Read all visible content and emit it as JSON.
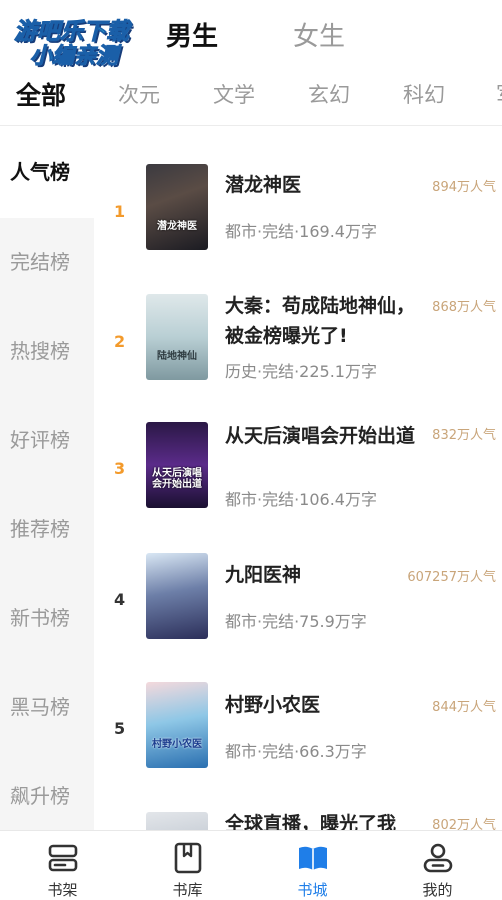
{
  "logo": {
    "line1": "游吧乐下载",
    "line2": "小编亲测"
  },
  "gender_tabs": {
    "male": "男生",
    "female": "女生",
    "active": "male"
  },
  "categories": [
    "全部",
    "次元",
    "文学",
    "玄幻",
    "科幻",
    "军"
  ],
  "rank_types": [
    "人气榜",
    "完结榜",
    "热搜榜",
    "好评榜",
    "推荐榜",
    "新书榜",
    "黑马榜",
    "飙升榜"
  ],
  "books": [
    {
      "rank": "1",
      "title": "潜龙神医",
      "meta": "都市·完结·169.4万字",
      "popularity": "894万人气",
      "cover_text": "潜龙神医"
    },
    {
      "rank": "2",
      "title": "大秦：苟成陆地神仙，被金榜曝光了!",
      "meta": "历史·完结·225.1万字",
      "popularity": "868万人气",
      "cover_text": "陆地神仙"
    },
    {
      "rank": "3",
      "title": "从天后演唱会开始出道",
      "meta": "都市·完结·106.4万字",
      "popularity": "832万人气",
      "cover_text": "从天后演唱会开始出道"
    },
    {
      "rank": "4",
      "title": "九阳医神",
      "meta": "都市·完结·75.9万字",
      "popularity": "607257万人气",
      "cover_text": ""
    },
    {
      "rank": "5",
      "title": "村野小农医",
      "meta": "都市·完结·66.3万字",
      "popularity": "844万人气",
      "cover_text": "村野小农医"
    },
    {
      "rank": "",
      "title": "全球直播，曝光了我",
      "meta": "",
      "popularity": "802万人气",
      "cover_text": ""
    }
  ],
  "bottom_nav": [
    {
      "label": "书架",
      "icon": "bookshelf-icon"
    },
    {
      "label": "书库",
      "icon": "library-icon"
    },
    {
      "label": "书城",
      "icon": "bookstore-icon",
      "active": true
    },
    {
      "label": "我的",
      "icon": "profile-icon"
    }
  ],
  "colors": {
    "accent": "#1f7ee8",
    "rank_top": "#f39a2b",
    "rank_normal": "#333333",
    "popularity": "#c9a57a"
  }
}
